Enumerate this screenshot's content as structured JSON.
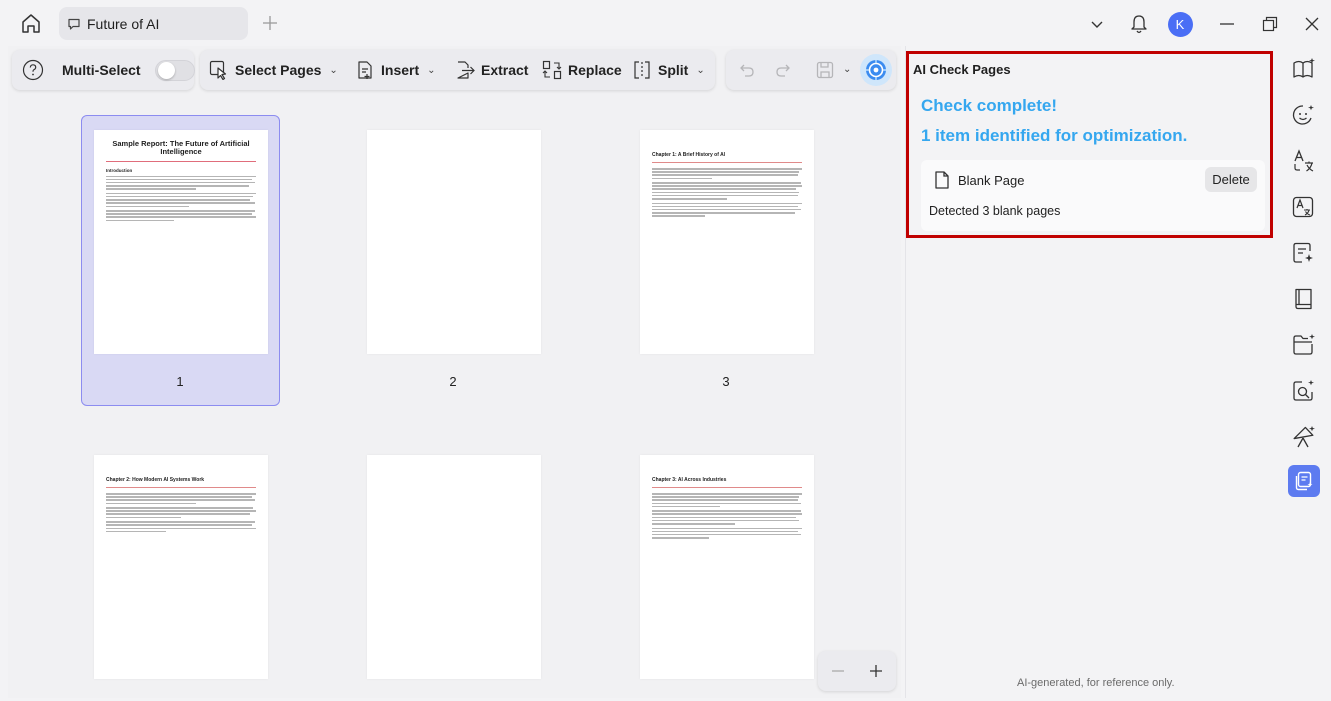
{
  "tab": {
    "title": "Future of AI"
  },
  "user": {
    "initial": "K"
  },
  "toolbar": {
    "multi_select_label": "Multi-Select",
    "select_pages_label": "Select Pages",
    "insert_label": "Insert",
    "extract_label": "Extract",
    "replace_label": "Replace",
    "split_label": "Split"
  },
  "pages": [
    {
      "number": "1",
      "selected": true,
      "title": "Sample Report: The Future of Artificial Intelligence",
      "heading": "Introduction"
    },
    {
      "number": "2",
      "blank": true
    },
    {
      "number": "3",
      "chapter": "Chapter 1: A Brief History of AI"
    },
    {
      "chapter": "Chapter 2: How Modern AI Systems Work"
    },
    {
      "blank": true
    },
    {
      "chapter": "Chapter 3: AI Across Industries"
    }
  ],
  "ai_panel": {
    "title": "AI Check Pages",
    "status": "Check complete!",
    "summary": "1 item identified for optimization.",
    "result": {
      "name": "Blank Page",
      "action": "Delete",
      "detail": "Detected 3 blank pages"
    },
    "footer": "AI-generated, for reference only."
  },
  "colors": {
    "accent": "#35a7ef",
    "highlight": "#c00000",
    "selection": "#d9d9f4",
    "active_rail": "#5d7bf0"
  }
}
